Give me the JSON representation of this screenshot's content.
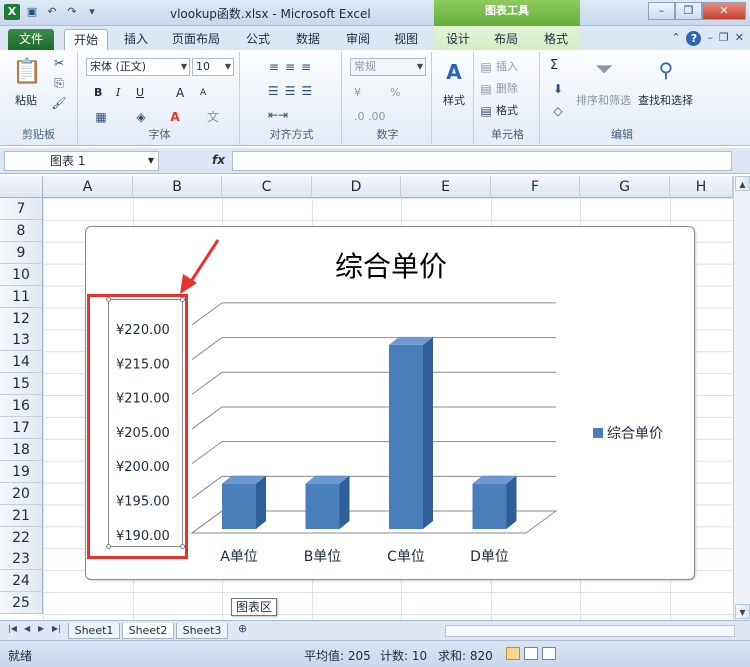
{
  "window": {
    "title": "vlookup函数.xlsx - Microsoft Excel",
    "context_title": "图表工具",
    "buttons": [
      "minimize",
      "restore",
      "close"
    ]
  },
  "tabs": {
    "file": "文件",
    "items": [
      "开始",
      "插入",
      "页面布局",
      "公式",
      "数据",
      "审阅",
      "视图",
      "设计",
      "布局",
      "格式"
    ],
    "active": "开始"
  },
  "ribbon": {
    "clipboard": {
      "paste": "粘贴",
      "label": "剪贴板"
    },
    "font": {
      "name": "宋体 (正文)",
      "size": "10",
      "label": "字体",
      "bold": "B",
      "italic": "I",
      "underline": "U",
      "grow": "A",
      "shrink": "A"
    },
    "alignment": {
      "label": "对齐方式"
    },
    "number": {
      "format": "常规",
      "percent": "%",
      "label": "数字"
    },
    "styles": {
      "label": "样式"
    },
    "cells": {
      "insert": "插入",
      "delete": "删除",
      "format": "格式",
      "label": "单元格"
    },
    "editing": {
      "sum": "Σ",
      "sort": "排序和筛选",
      "find": "查找和选择",
      "label": "编辑"
    }
  },
  "formula_bar": {
    "name_box": "图表 1",
    "fx": "fx",
    "value": ""
  },
  "columns": [
    "A",
    "B",
    "C",
    "D",
    "E",
    "F",
    "G",
    "H"
  ],
  "rows": [
    "7",
    "8",
    "9",
    "10",
    "11",
    "12",
    "13",
    "14",
    "15",
    "16",
    "17",
    "18",
    "19",
    "20",
    "21",
    "22",
    "23",
    "24",
    "25"
  ],
  "chart_data": {
    "type": "bar",
    "title": "综合单价",
    "categories": [
      "A单位",
      "B单位",
      "C单位",
      "D单位"
    ],
    "series": [
      {
        "name": "综合单价",
        "values": [
          200,
          200,
          220,
          200
        ],
        "color": "#4a7ebb"
      }
    ],
    "y_ticks": [
      "¥220.00",
      "¥215.00",
      "¥210.00",
      "¥205.00",
      "¥200.00",
      "¥195.00",
      "¥190.00"
    ],
    "ylim": [
      190,
      222
    ],
    "legend": "right",
    "grid": true,
    "three_d": true
  },
  "tooltip": "图表区",
  "sheets": [
    "Sheet1",
    "Sheet2",
    "Sheet3"
  ],
  "active_sheet": "Sheet2",
  "status": {
    "ready": "就绪",
    "average": "平均值: 205",
    "count": "计数: 10",
    "sum": "求和: 820"
  },
  "colors": {
    "accent": "#e8322a",
    "bar": "#4a7ebb",
    "file_tab": "#1d6b2c"
  }
}
